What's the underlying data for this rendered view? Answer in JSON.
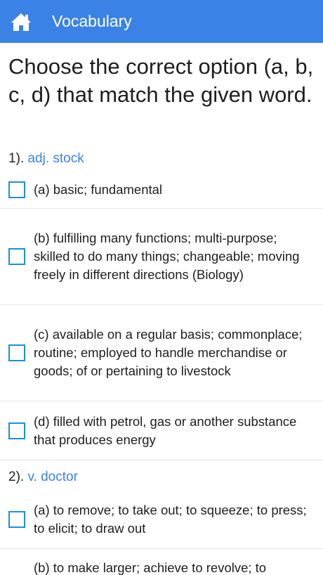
{
  "appbar": {
    "title": "Vocabulary",
    "home_icon": "home-icon",
    "color": "#3b82e6"
  },
  "instruction": "Choose the correct option (a, b, c, d) that match the given word.",
  "questions": [
    {
      "number": "1).",
      "word": "adj. stock",
      "options": [
        "(a) basic; fundamental",
        "(b) fulfilling many functions; multi-purpose; skilled to do many things; changeable; moving freely in different directions (Biology)",
        "(c) available on a regular basis; commonplace; routine; employed to handle merchandise or goods; of or pertaining to livestock",
        "(d) filled with petrol, gas or another substance that produces energy"
      ]
    },
    {
      "number": "2).",
      "word": "v. doctor",
      "options": [
        "(a) to remove; to take out; to squeeze; to press; to elicit; to draw out",
        "(b) to make larger; achieve to revolve; to"
      ]
    }
  ]
}
